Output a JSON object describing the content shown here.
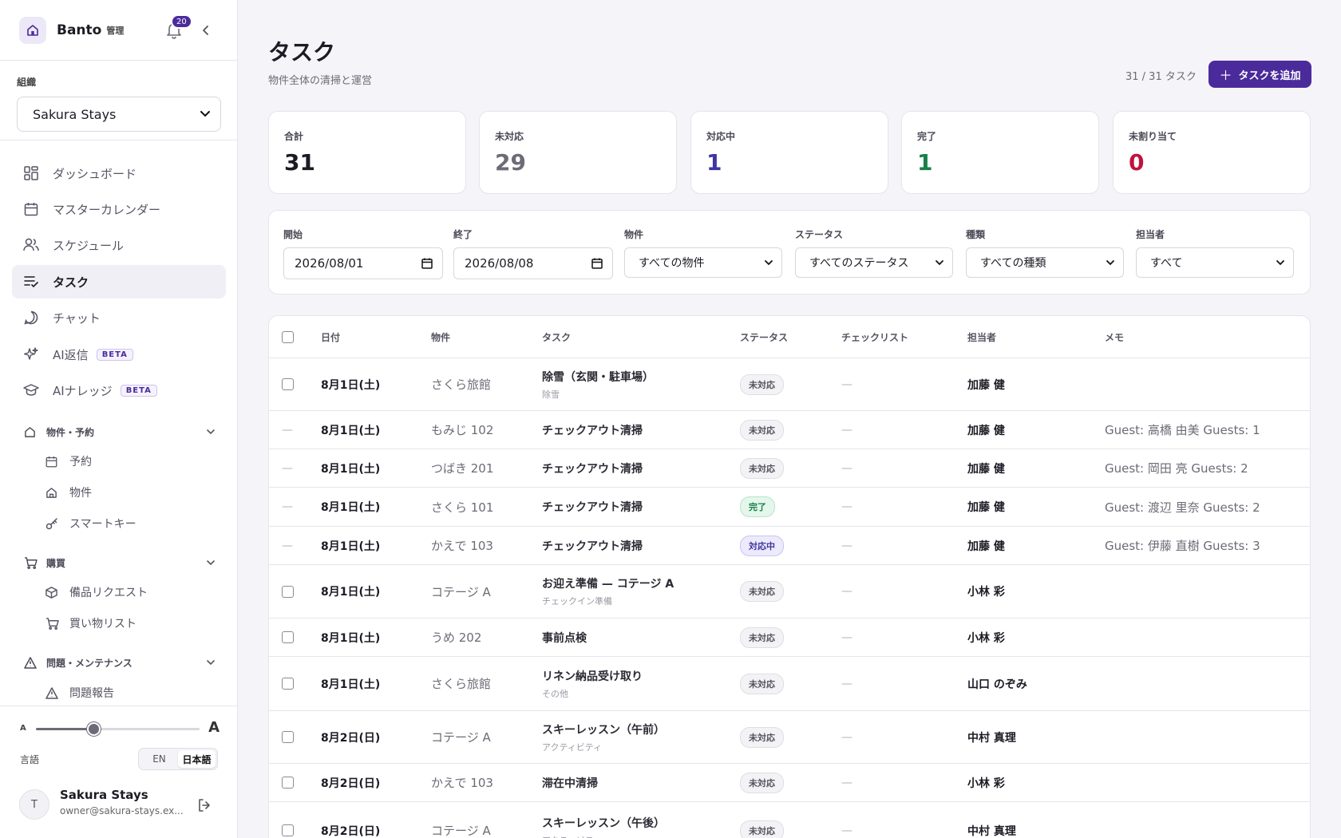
{
  "sidebar": {
    "brand": "Banto",
    "brand_sub": "管理",
    "notif_count": "20",
    "org_label": "組織",
    "org_value": "Sakura Stays",
    "nav": [
      {
        "label": "ダッシュボード",
        "icon": "grid-icon"
      },
      {
        "label": "マスターカレンダー",
        "icon": "calendar-icon"
      },
      {
        "label": "スケジュール",
        "icon": "users-icon"
      },
      {
        "label": "タスク",
        "icon": "task-list-icon",
        "active": true
      },
      {
        "label": "チャット",
        "icon": "chat-icon"
      },
      {
        "label": "AI返信",
        "icon": "sparkle-icon",
        "badge": "BETA"
      },
      {
        "label": "AIナレッジ",
        "icon": "graduation-cap-icon",
        "badge": "BETA"
      }
    ],
    "sections": [
      {
        "label": "物件・予約",
        "items": [
          "予約",
          "物件",
          "スマートキー"
        ]
      },
      {
        "label": "購買",
        "items": [
          "備品リクエスト",
          "買い物リスト"
        ]
      },
      {
        "label": "問題・メンテナンス",
        "items": [
          "問題報告"
        ]
      }
    ],
    "font_small": "A",
    "font_large": "A",
    "font_scale": 0.35,
    "lang_label": "言語",
    "lang_en": "EN",
    "lang_ja": "日本語",
    "user_initial": "T",
    "user_name": "Sakura Stays",
    "user_email": "owner@sakura-stays.ex..."
  },
  "header": {
    "title": "タスク",
    "subtitle": "物件全体の清掃と運営",
    "count": "31 / 31 タスク",
    "add_label": "タスクを追加"
  },
  "stats": [
    {
      "label": "合計",
      "value": "31",
      "color": "#1c1b24"
    },
    {
      "label": "未対応",
      "value": "29",
      "color": "#6c6b76"
    },
    {
      "label": "対応中",
      "value": "1",
      "color": "#3f36a3"
    },
    {
      "label": "完了",
      "value": "1",
      "color": "#17804a"
    },
    {
      "label": "未割り当て",
      "value": "0",
      "color": "#c0123c"
    }
  ],
  "filters": {
    "start_label": "開始",
    "start_value": "2026/08/01",
    "end_label": "終了",
    "end_value": "2026/08/08",
    "property_label": "物件",
    "property_value": "すべての物件",
    "status_label": "ステータス",
    "status_value": "すべてのステータス",
    "type_label": "種類",
    "type_value": "すべての種類",
    "assignee_label": "担当者",
    "assignee_value": "すべて"
  },
  "table": {
    "headers": [
      "日付",
      "物件",
      "タスク",
      "ステータス",
      "チェックリスト",
      "担当者",
      "メモ"
    ],
    "rows": [
      {
        "select": "checkbox",
        "date": "8月1日(土)",
        "property": "さくら旅館",
        "task": "除雪（玄関・駐車場）",
        "task_sub": "除雪",
        "status": "未対応",
        "status_kind": "open",
        "checklist": "—",
        "assignee": "加藤 健",
        "memo": ""
      },
      {
        "select": "dash",
        "date": "8月1日(土)",
        "property": "もみじ 102",
        "task": "チェックアウト清掃",
        "task_sub": "",
        "status": "未対応",
        "status_kind": "open",
        "checklist": "—",
        "assignee": "加藤 健",
        "memo": "Guest: 高橋 由美 Guests: 1"
      },
      {
        "select": "dash",
        "date": "8月1日(土)",
        "property": "つばき 201",
        "task": "チェックアウト清掃",
        "task_sub": "",
        "status": "未対応",
        "status_kind": "open",
        "checklist": "—",
        "assignee": "加藤 健",
        "memo": "Guest: 岡田 亮 Guests: 2"
      },
      {
        "select": "dash",
        "date": "8月1日(土)",
        "property": "さくら 101",
        "task": "チェックアウト清掃",
        "task_sub": "",
        "status": "完了",
        "status_kind": "done",
        "checklist": "—",
        "assignee": "加藤 健",
        "memo": "Guest: 渡辺 里奈 Guests: 2"
      },
      {
        "select": "dash",
        "date": "8月1日(土)",
        "property": "かえで 103",
        "task": "チェックアウト清掃",
        "task_sub": "",
        "status": "対応中",
        "status_kind": "inprog",
        "checklist": "—",
        "assignee": "加藤 健",
        "memo": "Guest: 伊藤 直樹 Guests: 3"
      },
      {
        "select": "checkbox",
        "date": "8月1日(土)",
        "property": "コテージ A",
        "task": "お迎え準備 — コテージ A",
        "task_sub": "チェックイン準備",
        "status": "未対応",
        "status_kind": "open",
        "checklist": "—",
        "assignee": "小林 彩",
        "memo": ""
      },
      {
        "select": "checkbox",
        "date": "8月1日(土)",
        "property": "うめ 202",
        "task": "事前点検",
        "task_sub": "",
        "status": "未対応",
        "status_kind": "open",
        "checklist": "—",
        "assignee": "小林 彩",
        "memo": ""
      },
      {
        "select": "checkbox",
        "date": "8月1日(土)",
        "property": "さくら旅館",
        "task": "リネン納品受け取り",
        "task_sub": "その他",
        "status": "未対応",
        "status_kind": "open",
        "checklist": "—",
        "assignee": "山口 のぞみ",
        "memo": ""
      },
      {
        "select": "checkbox",
        "date": "8月2日(日)",
        "property": "コテージ A",
        "task": "スキーレッスン（午前）",
        "task_sub": "アクティビティ",
        "status": "未対応",
        "status_kind": "open",
        "checklist": "—",
        "assignee": "中村 真理",
        "memo": ""
      },
      {
        "select": "checkbox",
        "date": "8月2日(日)",
        "property": "かえで 103",
        "task": "滞在中清掃",
        "task_sub": "",
        "status": "未対応",
        "status_kind": "open",
        "checklist": "—",
        "assignee": "小林 彩",
        "memo": ""
      },
      {
        "select": "checkbox",
        "date": "8月2日(日)",
        "property": "コテージ A",
        "task": "スキーレッスン（午後）",
        "task_sub": "アクティビティ",
        "status": "未対応",
        "status_kind": "open",
        "checklist": "—",
        "assignee": "中村 真理",
        "memo": ""
      }
    ]
  }
}
